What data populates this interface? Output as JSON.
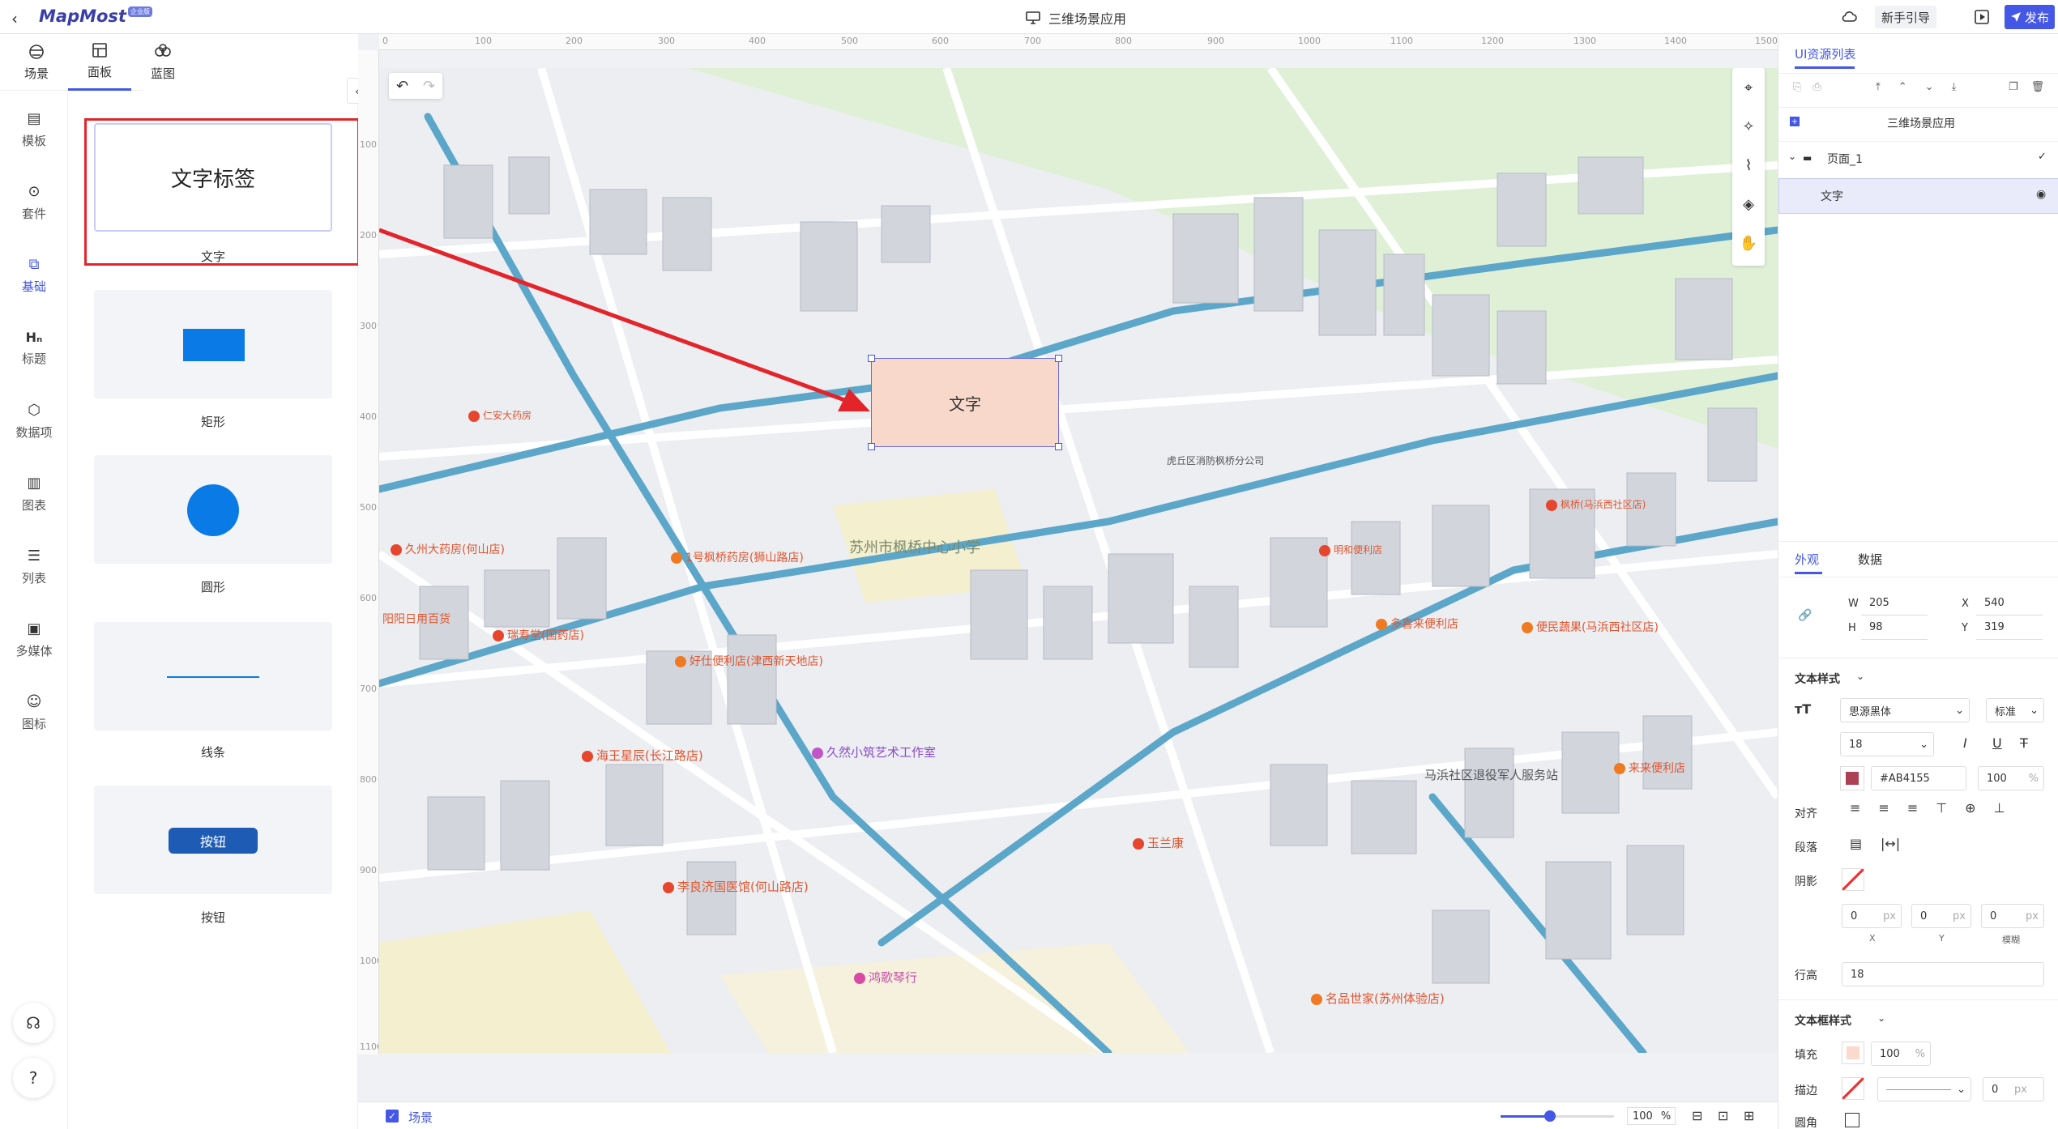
{
  "header": {
    "brand": "MapMost",
    "brand_badge": "企业版",
    "app_title": "三维场景应用",
    "guide_label": "新手引导",
    "publish_label": "发布"
  },
  "left_tabs": [
    {
      "label": "场景",
      "icon": "scene-icon"
    },
    {
      "label": "面板",
      "icon": "panel-icon"
    },
    {
      "label": "蓝图",
      "icon": "blueprint-icon"
    }
  ],
  "sidebar": {
    "items": [
      {
        "label": "模板",
        "icon": "template-icon"
      },
      {
        "label": "套件",
        "icon": "kit-icon"
      },
      {
        "label": "基础",
        "icon": "basic-icon"
      },
      {
        "label": "标题",
        "icon": "heading-icon"
      },
      {
        "label": "数据项",
        "icon": "data-item-icon"
      },
      {
        "label": "图表",
        "icon": "chart-icon"
      },
      {
        "label": "列表",
        "icon": "list-icon"
      },
      {
        "label": "多媒体",
        "icon": "media-icon"
      },
      {
        "label": "图标",
        "icon": "emoji-icon"
      }
    ]
  },
  "components": [
    {
      "label": "文字",
      "preview": "文字标签"
    },
    {
      "label": "矩形"
    },
    {
      "label": "圆形"
    },
    {
      "label": "线条"
    },
    {
      "label": "按钮",
      "preview": "按钮"
    }
  ],
  "canvas": {
    "selected_text": "文字",
    "ruler_h": [
      "0",
      "100",
      "200",
      "300",
      "400",
      "500",
      "600",
      "700",
      "800",
      "900",
      "1000",
      "1100",
      "1200",
      "1300",
      "1400",
      "1500"
    ],
    "ruler_v": [
      "100",
      "200",
      "300",
      "400",
      "500",
      "600",
      "700",
      "800",
      "900",
      "1000",
      "1100"
    ],
    "map_labels": [
      "苏州市枫桥中心小学",
      "久然小筑艺术工作室",
      "鸿歌琴行",
      "名品世家(苏州体验店)",
      "马浜社区退役军人服务站",
      "李良济国医馆(何山路店)",
      "海王星辰(长江路店)",
      "好仕便利店(津西新天地店)",
      "瑞寿堂(国药店)",
      "久州大药房(何山店)",
      "阳阳日用百货",
      "1号枫桥药房(狮山路店)",
      "玉兰康",
      "便民蔬果(马浜西社区店)",
      "多喜来便利店",
      "来来便利店",
      "仁安大药房",
      "虎丘区消防枫桥分公司",
      "明和便利店",
      "枫桥(马浜西社区店)"
    ]
  },
  "bottom": {
    "scene_label": "场景",
    "zoom": "100",
    "zoom_unit": "%"
  },
  "right": {
    "tab_title": "UI资源列表",
    "tree": {
      "root": "三维场景应用",
      "page": "页面_1",
      "item": "文字"
    },
    "prop_tabs": [
      "外观",
      "数据"
    ],
    "size": {
      "w_label": "W",
      "w": "205",
      "h_label": "H",
      "h": "98",
      "x_label": "X",
      "x": "540",
      "y_label": "Y",
      "y": "319"
    },
    "text_style_title": "文本样式",
    "font_family": "思源黑体",
    "font_weight": "标准",
    "font_size": "18",
    "color_hex": "#AB4155",
    "color_value": "#AB4155",
    "opacity": "100",
    "percent": "%",
    "align_label": "对齐",
    "paragraph_label": "段落",
    "shadow_label": "阴影",
    "shadow": {
      "x": "0",
      "y": "0",
      "blur": "0",
      "unit": "px",
      "x_label": "X",
      "y_label": "Y",
      "blur_label": "模糊"
    },
    "line_height_label": "行高",
    "line_height": "18",
    "box_style_title": "文本框样式",
    "fill_label": "填充",
    "fill_color": "#F9DACC",
    "fill_opacity": "100",
    "stroke_label": "描边",
    "stroke_width": "0",
    "radius_label": "圆角"
  },
  "colors": {
    "accent": "#4457e6",
    "highlight": "#e3242b",
    "selected_fill": "#f8d8cb"
  }
}
